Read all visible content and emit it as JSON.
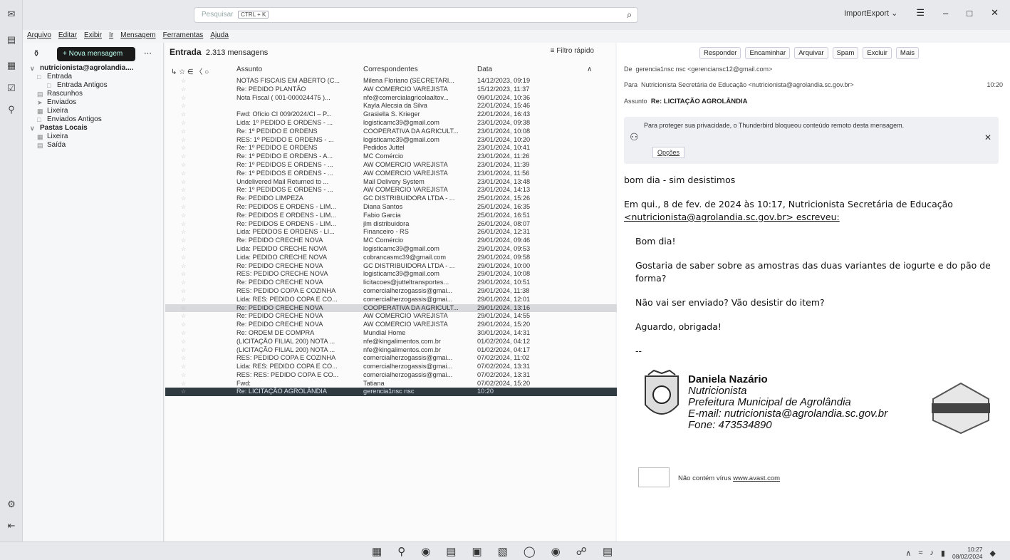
{
  "window": {
    "search_placeholder": "Pesquisar",
    "search_kbd": "CTRL + K",
    "import_export": "ImportExport ⌄"
  },
  "menubar": [
    "Arquivo",
    "Editar",
    "Exibir",
    "Ir",
    "Mensagem",
    "Ferramentas",
    "Ajuda"
  ],
  "folders": {
    "new_message": "+ Nova mensagem",
    "account": "nutricionista@agrolandia....",
    "items": [
      {
        "label": "Entrada",
        "indent": 1
      },
      {
        "label": "Entrada Antigos",
        "indent": 2
      },
      {
        "label": "Rascunhos",
        "indent": 1
      },
      {
        "label": "Enviados",
        "indent": 1
      },
      {
        "label": "Lixeira",
        "indent": 1
      },
      {
        "label": "Enviados Antigos",
        "indent": 1
      }
    ],
    "local": "Pastas Locais",
    "local_items": [
      "Lixeira",
      "Saída"
    ]
  },
  "list": {
    "folder": "Entrada",
    "count": "2.313 mensagens",
    "quick_filter": "Filtro rápido",
    "columns": {
      "subject": "Assunto",
      "correspondents": "Correspondentes",
      "date": "Data"
    },
    "rows": [
      [
        "NOTAS FISCAIS EM ABERTO (C...",
        "Milena Floriano (SECRETARI...",
        "14/12/2023, 09:19"
      ],
      [
        "Re: PEDIDO PLANTÃO",
        "AW COMERCIO VAREJISTA",
        "15/12/2023, 11:37"
      ],
      [
        "Nota Fiscal ( 001-000024475 )...",
        "nfe@comercialagricolaaltov...",
        "09/01/2024, 10:36"
      ],
      [
        "",
        "Kayla Alecsia da Silva",
        "22/01/2024, 15:46"
      ],
      [
        "Fwd: Ofício CI 009/2024/CI – P...",
        "Grasiella S. Krieger",
        "22/01/2024, 16:43"
      ],
      [
        "Lida: 1º PEDIDO E ORDENS - ...",
        "logisticamc39@gmail.com",
        "23/01/2024, 09:38"
      ],
      [
        "Re: 1º PEDIDO E ORDENS",
        "COOPERATIVA DA AGRICULT...",
        "23/01/2024, 10:08"
      ],
      [
        "RES: 1º PEDIDO E ORDENS - ...",
        "logisticamc39@gmail.com",
        "23/01/2024, 10:20"
      ],
      [
        "Re: 1º PEDIDO E ORDENS",
        "Pedidos Juttel",
        "23/01/2024, 10:41"
      ],
      [
        "Re: 1º PEDIDO E ORDENS - A...",
        "MC Comércio",
        "23/01/2024, 11:26"
      ],
      [
        "Re: 1º PEDIDOS E ORDENS - ...",
        "AW COMERCIO VAREJISTA",
        "23/01/2024, 11:39"
      ],
      [
        "Re: 1º PEDIDOS E ORDENS - ...",
        "AW COMERCIO VAREJISTA",
        "23/01/2024, 11:56"
      ],
      [
        "Undelivered Mail Returned to ...",
        "Mail Delivery System",
        "23/01/2024, 13:48"
      ],
      [
        "Re: 1º PEDIDOS E ORDENS - ...",
        "AW COMERCIO VAREJISTA",
        "23/01/2024, 14:13"
      ],
      [
        "Re: PEDIDO LIMPEZA",
        "GC DISTRIBUIDORA LTDA - ...",
        "25/01/2024, 15:26"
      ],
      [
        "Re: PEDIDOS E ORDENS - LIM...",
        "Diana Santos",
        "25/01/2024, 16:35"
      ],
      [
        "Re: PEDIDOS E ORDENS - LIM...",
        "Fabio Garcia",
        "25/01/2024, 16:51"
      ],
      [
        "Re: PEDIDOS E ORDENS - LIM...",
        "jlm distribuidora",
        "26/01/2024, 08:07"
      ],
      [
        "Lida: PEDIDOS E ORDENS - LI...",
        "Financeiro - RS",
        "26/01/2024, 12:31"
      ],
      [
        "Re: PEDIDO CRECHE NOVA",
        "MC Comércio",
        "29/01/2024, 09:46"
      ],
      [
        "Lida: PEDIDO CRECHE NOVA",
        "logisticamc39@gmail.com",
        "29/01/2024, 09:53"
      ],
      [
        "Lida: PEDIDO CRECHE NOVA",
        "cobrancasmc39@gmail.com",
        "29/01/2024, 09:58"
      ],
      [
        "Re: PEDIDO CRECHE NOVA",
        "GC DISTRIBUIDORA LTDA - ...",
        "29/01/2024, 10:00"
      ],
      [
        "RES: PEDIDO CRECHE NOVA",
        "logisticamc39@gmail.com",
        "29/01/2024, 10:08"
      ],
      [
        "Re: PEDIDO CRECHE NOVA",
        "licitacoes@jutteltransportes...",
        "29/01/2024, 10:51"
      ],
      [
        "RES: PEDIDO COPA E COZINHA",
        "comercialherzogassis@gmai...",
        "29/01/2024, 11:38"
      ],
      [
        "Lida: RES: PEDIDO COPA E CO...",
        "comercialherzogassis@gmai...",
        "29/01/2024, 12:01"
      ],
      [
        "Re: PEDIDO CRECHE NOVA",
        "COOPERATIVA DA AGRICULT...",
        "29/01/2024, 13:16"
      ],
      [
        "Re: PEDIDO CRECHE NOVA",
        "AW COMERCIO VAREJISTA",
        "29/01/2024, 14:55"
      ],
      [
        "Re: PEDIDO CRECHE NOVA",
        "AW COMERCIO VAREJISTA",
        "29/01/2024, 15:20"
      ],
      [
        "Re: ORDEM DE COMPRA",
        "Mundial Home",
        "30/01/2024, 14:31"
      ],
      [
        "(LICITAÇÃO FILIAL 200) NOTA ...",
        "nfe@kingalimentos.com.br",
        "01/02/2024, 04:12"
      ],
      [
        "(LICITAÇÃO FILIAL 200) NOTA ...",
        "nfe@kingalimentos.com.br",
        "01/02/2024, 04:17"
      ],
      [
        "RES: PEDIDO COPA E COZINHA",
        "comercialherzogassis@gmai...",
        "07/02/2024, 11:02"
      ],
      [
        "Lida: RES: PEDIDO COPA E CO...",
        "comercialherzogassis@gmai...",
        "07/02/2024, 13:31"
      ],
      [
        "RES: RES: PEDIDO COPA E CO...",
        "comercialherzogassis@gmai...",
        "07/02/2024, 13:31"
      ],
      [
        "Fwd:",
        "Tatiana",
        "07/02/2024, 15:20"
      ],
      [
        "Re: LICITAÇÃO AGROLÂNDIA",
        "gerencia1nsc nsc",
        "10:20"
      ]
    ]
  },
  "reader": {
    "buttons": [
      "Responder",
      "Encaminhar",
      "Arquivar",
      "Spam",
      "Excluir",
      "Mais"
    ],
    "from_label": "De",
    "from": "gerencia1nsc nsc <gerenciansc12@gmail.com>",
    "to_label": "Para",
    "to": "Nutricionista Secretária de Educação <nutricionista@agrolandia.sc.gov.br>",
    "time": "10:20",
    "subject_label": "Assunto",
    "subject": "Re: LICITAÇÃO AGROLÂNDIA",
    "remote_warning": "Para proteger sua privacidade, o Thunderbird bloqueou conteúdo remoto desta mensagem.",
    "options": "Opções",
    "body": [
      "bom dia  - sim desistimos",
      "Em qui., 8 de fev. de 2024 às 10:17, Nutricionista Secretária de Educação",
      "<nutricionista@agrolandia.sc.gov.br> escreveu:",
      "Bom dia!",
      "Gostaria de saber sobre as amostras das duas variantes de iogurte e do pão de forma?",
      "Não vai ser enviado? Vão desistir do item?",
      "Aguardo, obrigada!",
      "--"
    ],
    "signature": [
      "Daniela Nazário",
      "Nutricionista",
      "Prefeitura Municipal de Agrolândia",
      "E-mail: nutricionista@agrolandia.sc.gov.br",
      "Fone:  473534890"
    ],
    "avast_text": "Não contém vírus",
    "avast_link": "www.avast.com"
  },
  "taskbar": {
    "time": "10:27",
    "date": "08/02/2024"
  }
}
